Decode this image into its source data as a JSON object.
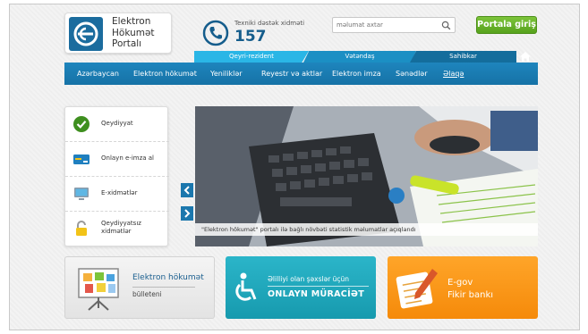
{
  "header": {
    "logo_lines": [
      "Elektron",
      "Hökumət",
      "Portalı"
    ],
    "support_label": "Texniki dəstək xidməti",
    "support_number": "157",
    "search_placeholder": "məlumat axtar",
    "portal_button": "Portala giriş"
  },
  "audience_tabs": [
    "Qeyri-rezident",
    "Vətəndaş",
    "Sahibkar"
  ],
  "nav": [
    "Azərbaycan",
    "Elektron hökumət",
    "Yeniliklər",
    "Reyestr və aktlar",
    "Elektron imza",
    "Sənədlər",
    "Əlaqə"
  ],
  "left_panel": [
    {
      "label": "Qeydiyyat",
      "icon": "checkmark-icon"
    },
    {
      "label": "Onlayn e-imza al",
      "icon": "card-icon"
    },
    {
      "label": "E-xidmətlər",
      "icon": "monitor-icon"
    },
    {
      "label": "Qeydiyyatsız xidmətlər",
      "icon": "unlock-icon"
    }
  ],
  "slider": {
    "caption": "\"Elektron hökumət\" portalı ilə bağlı növbəti statistik məlumatlar açıqlandı"
  },
  "tiles": {
    "bulletin": {
      "title": "Elektron hökumət",
      "subtitle": "bülleteni"
    },
    "disability": {
      "title": "Əlilliyi olan şəxslər üçün",
      "subtitle": "ONLAYN MÜRACİƏT"
    },
    "egov": {
      "title": "E-gov",
      "subtitle": "Fikir bankı"
    }
  },
  "colors": {
    "brand_blue": "#1672a6",
    "green": "#57a21d",
    "teal": "#179aae",
    "orange": "#f58a0a"
  }
}
